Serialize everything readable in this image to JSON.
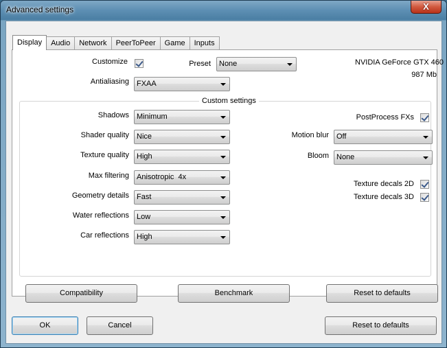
{
  "window": {
    "title": "Advanced settings",
    "close_glyph": "X"
  },
  "tabs": [
    {
      "label": "Display",
      "active": true
    },
    {
      "label": "Audio"
    },
    {
      "label": "Network"
    },
    {
      "label": "PeerToPeer"
    },
    {
      "label": "Game"
    },
    {
      "label": "Inputs"
    }
  ],
  "display": {
    "customize_label": "Customize",
    "customize_checked": true,
    "preset_label": "Preset",
    "preset_value": "None",
    "gpu_name": "NVIDIA GeForce GTX 460",
    "gpu_memory": "987 Mb",
    "antialiasing_label": "Antialiasing",
    "antialiasing_value": "FXAA"
  },
  "custom": {
    "title": "Custom settings",
    "shadows_label": "Shadows",
    "shadows_value": "Minimum",
    "shader_label": "Shader quality",
    "shader_value": "Nice",
    "texture_label": "Texture quality",
    "texture_value": "High",
    "filtering_label": "Max filtering",
    "filtering_value": "Anisotropic  4x",
    "geometry_label": "Geometry details",
    "geometry_value": "Fast",
    "water_label": "Water reflections",
    "water_value": "Low",
    "car_label": "Car reflections",
    "car_value": "High",
    "postprocess_label": "PostProcess FXs",
    "postprocess_checked": true,
    "motionblur_label": "Motion blur",
    "motionblur_value": "Off",
    "bloom_label": "Bloom",
    "bloom_value": "None",
    "decals2d_label": "Texture decals 2D",
    "decals2d_checked": true,
    "decals3d_label": "Texture decals 3D",
    "decals3d_checked": true
  },
  "panel_buttons": {
    "compatibility": "Compatibility",
    "benchmark": "Benchmark",
    "reset": "Reset to defaults"
  },
  "dialog_buttons": {
    "ok": "OK",
    "cancel": "Cancel",
    "reset": "Reset to defaults"
  },
  "colors": {
    "titlebar": "#5d8fb3",
    "close_button": "#d1593f",
    "default_button_border": "#3c7fb1"
  }
}
